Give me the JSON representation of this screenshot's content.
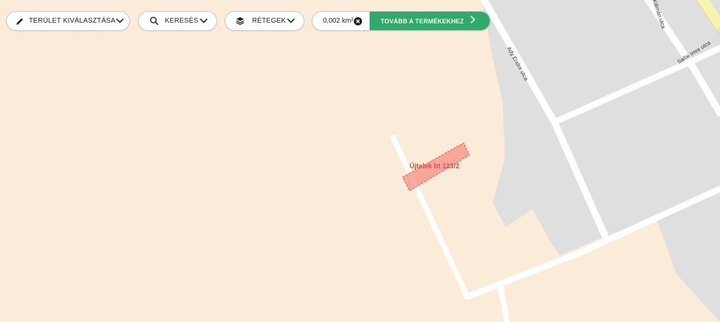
{
  "toolbar": {
    "area_select_label": "Terület kiválasztása",
    "search_label": "Keresés",
    "layers_label": "Rétegek",
    "area_value": "0,002 km²",
    "next_label": "Tovább a termékekhez"
  },
  "map": {
    "parcel_label": "Újtelek bt 123/2",
    "streets": [
      "Ady Endre utca",
      "Kálmán utca",
      "Sallai Imre utca"
    ],
    "colors": {
      "land": "#fbecda",
      "built_block": "#dfdfdf",
      "road": "#ffffff",
      "main_road": "#f7f3b0",
      "parcel_fill": "#f59b8e",
      "parcel_stroke": "#e0544a",
      "accent": "#2eaa6a"
    }
  },
  "icons": {
    "area_select": "pencil-icon",
    "search": "search-icon",
    "layers": "layers-icon",
    "clear": "close-circle-icon",
    "dropdown": "chevron-down-icon",
    "next": "chevron-right-icon"
  }
}
